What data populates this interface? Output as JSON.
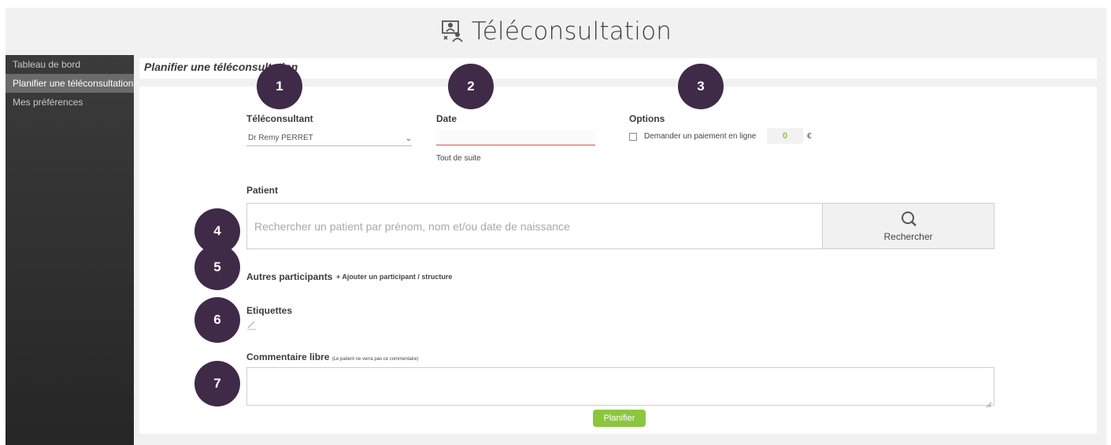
{
  "header": {
    "title": "Téléconsultation",
    "icon": "teleconsultation-icon"
  },
  "sidebar": {
    "items": [
      {
        "label": "Tableau de bord",
        "active": false
      },
      {
        "label": "Planifier une téléconsultation",
        "active": true
      },
      {
        "label": "Mes préférences",
        "active": false
      }
    ]
  },
  "page": {
    "title": "Planifier une téléconsultation"
  },
  "form": {
    "teleconsultant_label": "Téléconsultant",
    "teleconsultant_value": "Dr Remy PERRET",
    "date_label": "Date",
    "date_value": "",
    "date_hint": "Tout de suite",
    "options_label": "Options",
    "payment_label": "Demander un paiement en ligne",
    "payment_amount": "0",
    "currency": "€",
    "patient_label": "Patient",
    "patient_placeholder": "Rechercher un patient par prénom, nom et/ou date de naissance",
    "search_button": "Rechercher",
    "participants_label": "Autres participants",
    "add_participant": "+ Ajouter un participant / structure",
    "tags_label": "Etiquettes",
    "comment_label": "Commentaire libre",
    "comment_note": "(Le patient ne verra pas ce commentaire)",
    "submit": "Planifier"
  },
  "markers": [
    "1",
    "2",
    "3",
    "4",
    "5",
    "6",
    "7"
  ],
  "colors": {
    "accent": "#8cc63f",
    "marker": "#3f2a48",
    "sidebar": "#2f2f2f",
    "sidebar_active": "#6b6b6b",
    "error_underline": "#d9534f"
  }
}
